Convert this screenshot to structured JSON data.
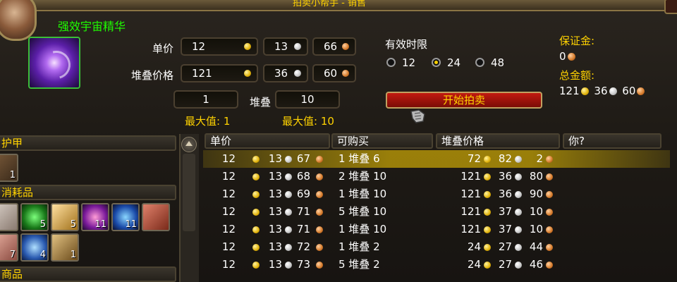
{
  "window": {
    "title": "拍卖小帮手 - 销售"
  },
  "item": {
    "name": "强效宇宙精华",
    "icon": "cosmic-essence-icon"
  },
  "sell_form": {
    "unit_price_label": "单价",
    "unit_price": {
      "gold": "12",
      "silver": "13",
      "copper": "66"
    },
    "stack_price_label": "堆叠价格",
    "stack_price": {
      "gold": "121",
      "silver": "36",
      "copper": "60"
    },
    "stacks_count": "1",
    "stack_label": "堆叠",
    "stack_size": "10",
    "max_stacks": "最大值: 1",
    "max_stack_size": "最大值: 10"
  },
  "duration": {
    "label": "有效时限",
    "options": [
      "12",
      "24",
      "48"
    ],
    "selected": "24"
  },
  "start_button": "开始拍卖",
  "summary": {
    "deposit_label": "保证金:",
    "deposit_value": "0",
    "total_label": "总金额:",
    "total_gold": "121",
    "total_silver": "36",
    "total_copper": "60"
  },
  "categories": {
    "armor": "护甲",
    "consumables": "消耗品",
    "goods": "商品",
    "armor_slots": [
      {
        "icon": "armor-item-icon",
        "count": "1"
      }
    ],
    "consumable_slots": [
      {
        "icon": "meat-icon",
        "count": ""
      },
      {
        "icon": "green-gem-icon",
        "count": "5"
      },
      {
        "icon": "scroll-icon",
        "count": "5"
      },
      {
        "icon": "purple-potion-icon",
        "count": "11"
      },
      {
        "icon": "blue-potion-icon",
        "count": "11"
      },
      {
        "icon": "red-meat-icon",
        "count": ""
      },
      {
        "icon": "pink-meat-icon",
        "count": "7"
      },
      {
        "icon": "blue-crystal-icon",
        "count": "4"
      },
      {
        "icon": "fish-skewer-icon",
        "count": "1"
      }
    ]
  },
  "results": {
    "headers": [
      "单价",
      "可购买",
      "堆叠价格",
      "你?"
    ],
    "rows": [
      {
        "ug": "12",
        "us": "13",
        "uc": "67",
        "avail": "1 堆叠 6",
        "sg": "72",
        "ss": "82",
        "sc": "2",
        "selected": true
      },
      {
        "ug": "12",
        "us": "13",
        "uc": "68",
        "avail": "2 堆叠 10",
        "sg": "121",
        "ss": "36",
        "sc": "80"
      },
      {
        "ug": "12",
        "us": "13",
        "uc": "69",
        "avail": "1 堆叠 10",
        "sg": "121",
        "ss": "36",
        "sc": "90"
      },
      {
        "ug": "12",
        "us": "13",
        "uc": "71",
        "avail": "5 堆叠 10",
        "sg": "121",
        "ss": "37",
        "sc": "10"
      },
      {
        "ug": "12",
        "us": "13",
        "uc": "71",
        "avail": "1 堆叠 10",
        "sg": "121",
        "ss": "37",
        "sc": "10"
      },
      {
        "ug": "12",
        "us": "13",
        "uc": "72",
        "avail": "1 堆叠 2",
        "sg": "24",
        "ss": "27",
        "sc": "44"
      },
      {
        "ug": "12",
        "us": "13",
        "uc": "73",
        "avail": "5 堆叠 2",
        "sg": "24",
        "ss": "27",
        "sc": "46"
      }
    ]
  },
  "colors": {
    "gold_text": "#ffd200",
    "item_green": "#1eff00",
    "selected_row": "#e0b100"
  }
}
